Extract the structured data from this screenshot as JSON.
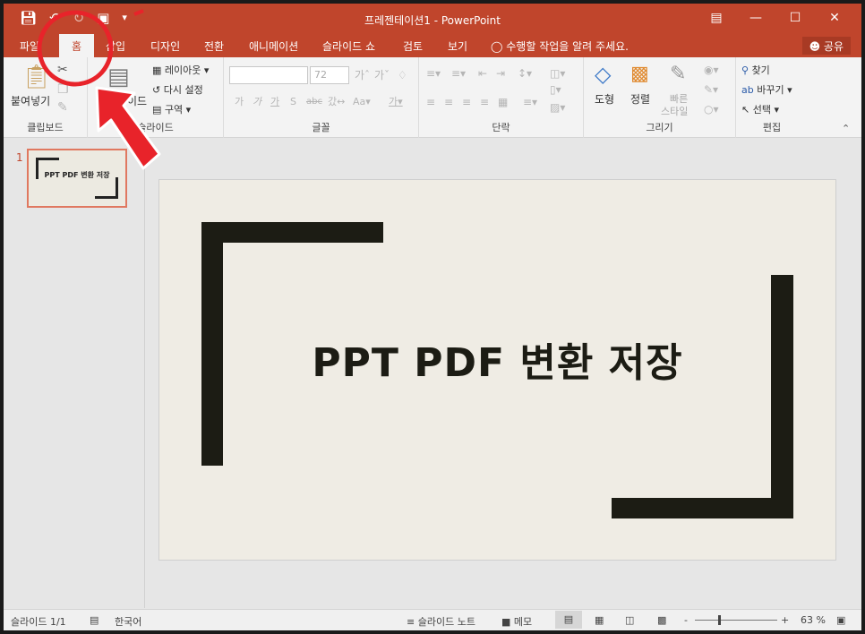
{
  "window": {
    "title": "프레젠테이션1 - PowerPoint",
    "accent": "#c0452c"
  },
  "qat": {
    "save_icon": "save-icon",
    "undo_icon": "undo-icon",
    "redo_icon": "redo-icon",
    "present_icon": "present-icon",
    "customize_icon": "customize-icon"
  },
  "controls": {
    "ribbon_display": "ribbon-display-icon",
    "minimize": "minimize-icon",
    "maximize": "maximize-icon",
    "close": "close-icon"
  },
  "tabs": [
    "파일",
    "홈",
    "삽입",
    "디자인",
    "전환",
    "애니메이션",
    "슬라이드 쇼",
    "검토",
    "보기"
  ],
  "active_tab": "홈",
  "tell_me": "수행할 작업을 알려 주세요.",
  "share": "공유",
  "ribbon": {
    "clipboard": {
      "paste": "붙여넣기",
      "label": "클립보드"
    },
    "slides": {
      "new_slide": "이드",
      "layout": "레이아웃",
      "reset": "다시 설정",
      "section": "구역",
      "label": "슬라이드"
    },
    "font": {
      "size": "72",
      "label": "글꼴"
    },
    "paragraph": {
      "label": "단락"
    },
    "drawing": {
      "shapes": "도형",
      "arrange": "정렬",
      "quick_styles_1": "빠른",
      "quick_styles_2": "스타일",
      "label": "그리기"
    },
    "editing": {
      "find": "찾기",
      "replace": "바꾸기",
      "select": "선택",
      "label": "편집"
    }
  },
  "slides_pane": {
    "number": "1",
    "thumb_title": "PPT PDF 변환 저장"
  },
  "slide": {
    "title": "PPT PDF 변환 저장"
  },
  "status": {
    "slide_count": "슬라이드 1/1",
    "language": "한국어",
    "notes": "슬라이드 노트",
    "comments": "메모",
    "zoom_minus": "-",
    "zoom_plus": "+",
    "zoom": "63 %"
  }
}
